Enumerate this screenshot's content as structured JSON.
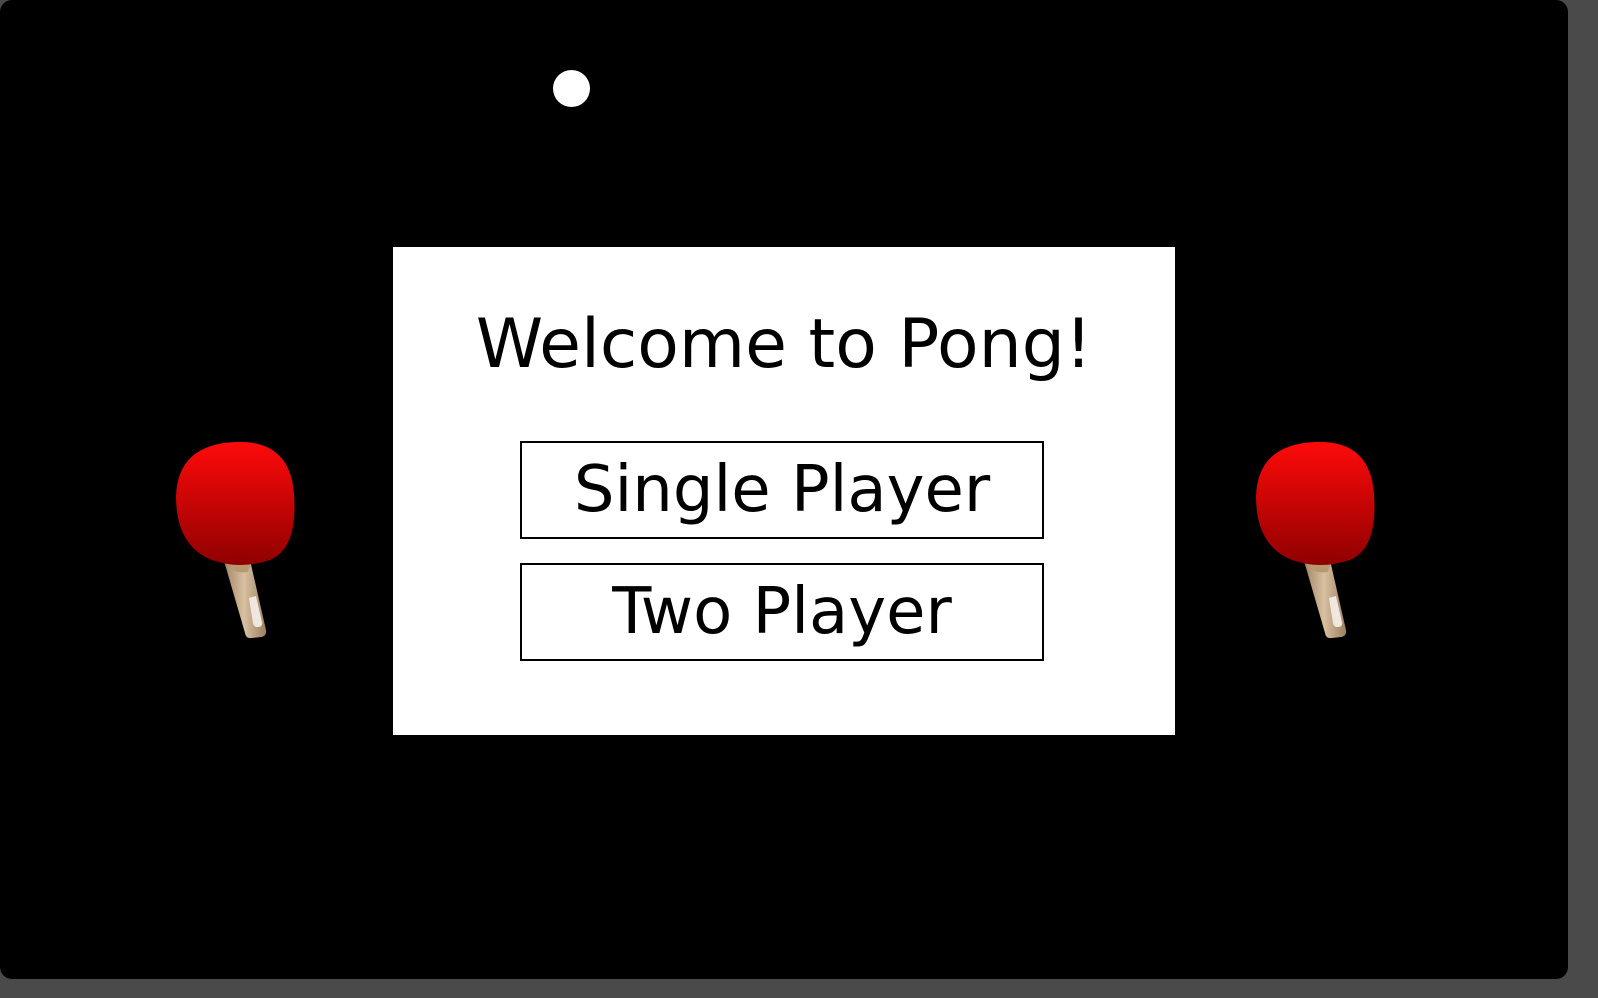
{
  "game": {
    "title": "Welcome to Pong!",
    "buttons": {
      "single_player": "Single Player",
      "two_player": "Two Player"
    }
  },
  "scene": {
    "ball_icon": "ball",
    "left_paddle_icon": "ping-pong-paddle",
    "right_paddle_icon": "ping-pong-paddle"
  },
  "colors": {
    "background": "#000000",
    "panel": "#ffffff",
    "ball": "#ffffff",
    "paddle_rubber": "#d40000",
    "paddle_handle": "#c8a980"
  }
}
